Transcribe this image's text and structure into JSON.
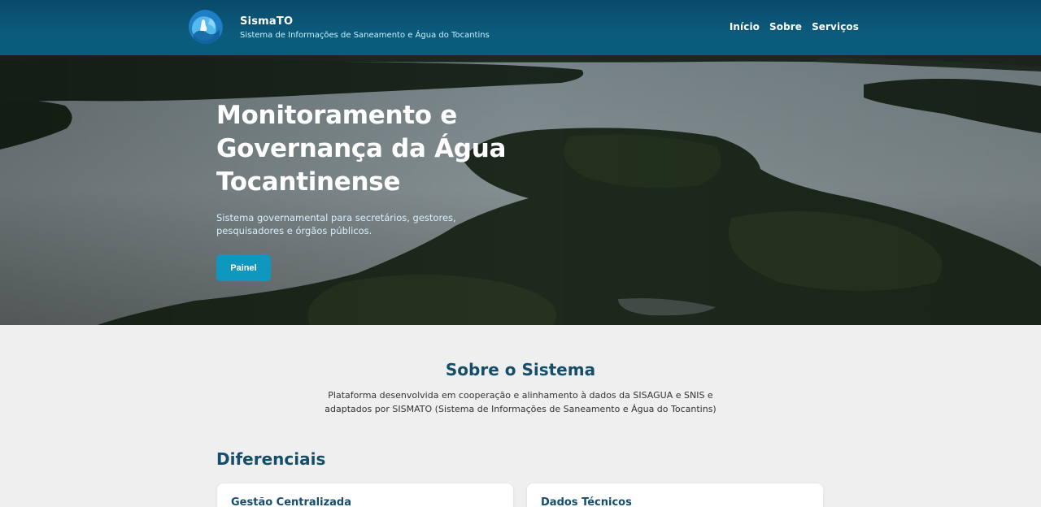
{
  "header": {
    "brand_name": "SismaTO",
    "brand_subtitle": "Sistema de Informações de Saneamento e Água do Tocantins",
    "nav": [
      {
        "label": "Início"
      },
      {
        "label": "Sobre"
      },
      {
        "label": "Serviços"
      }
    ]
  },
  "hero": {
    "title": "Monitoramento e Governança da Água Tocantinense",
    "description": "Sistema governamental para secretários, gestores, pesquisadores e órgãos públicos.",
    "button_label": "Painel"
  },
  "about": {
    "title": "Sobre o Sistema",
    "text": "Plataforma desenvolvida em cooperação e alinhamento à dados da SISAGUA e SNIS e adaptados por SISMATO (Sistema de Informações de Saneamento e Água do Tocantins)"
  },
  "differentials": {
    "title": "Diferenciais",
    "cards": [
      {
        "title": "Gestão Centralizada"
      },
      {
        "title": "Dados Técnicos"
      }
    ]
  },
  "colors": {
    "header_bg": "#0b5b7c",
    "accent": "#1097bf",
    "heading": "#144e6b",
    "page_bg": "#efefef"
  }
}
